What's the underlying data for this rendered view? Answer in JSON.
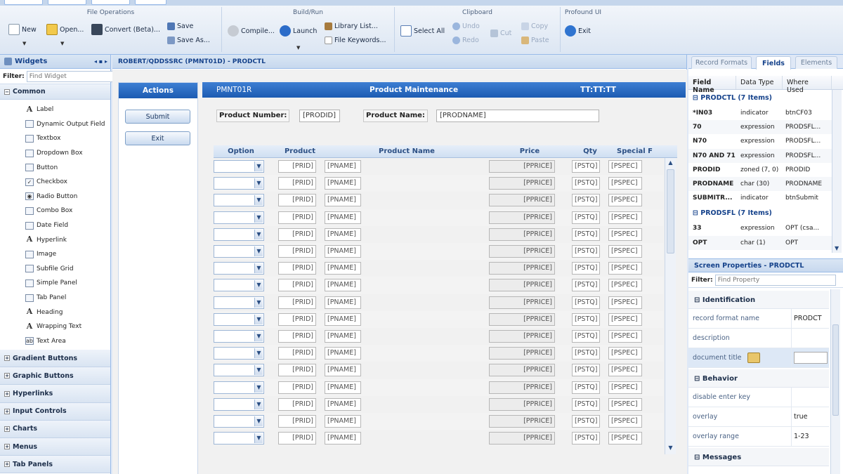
{
  "ribbon": {
    "groups": {
      "file_operations": "File Operations",
      "build_run": "Build/Run",
      "clipboard": "Clipboard",
      "profound_ui": "Profound UI"
    },
    "buttons": {
      "new": "New",
      "open": "Open...",
      "convert": "Convert (Beta)...",
      "save": "Save",
      "save_as": "Save As...",
      "compile": "Compile...",
      "launch": "Launch",
      "library_list": "Library List...",
      "file_keywords": "File Keywords...",
      "select_all": "Select All",
      "undo": "Undo",
      "redo": "Redo",
      "cut": "Cut",
      "copy": "Copy",
      "paste": "Paste",
      "exit": "Exit"
    }
  },
  "widgets": {
    "title": "Widgets",
    "filter_label": "Filter:",
    "filter_placeholder": "Find Widget",
    "common_label": "Common",
    "items": [
      {
        "label": "Label",
        "icon": "A"
      },
      {
        "label": "Dynamic Output Field",
        "icon": ""
      },
      {
        "label": "Textbox",
        "icon": ""
      },
      {
        "label": "Dropdown Box",
        "icon": ""
      },
      {
        "label": "Button",
        "icon": ""
      },
      {
        "label": "Checkbox",
        "icon": "✓"
      },
      {
        "label": "Radio Button",
        "icon": "◉"
      },
      {
        "label": "Combo Box",
        "icon": ""
      },
      {
        "label": "Date Field",
        "icon": ""
      },
      {
        "label": "Hyperlink",
        "icon": "A"
      },
      {
        "label": "Image",
        "icon": ""
      },
      {
        "label": "Subfile Grid",
        "icon": ""
      },
      {
        "label": "Simple Panel",
        "icon": ""
      },
      {
        "label": "Tab Panel",
        "icon": ""
      },
      {
        "label": "Heading",
        "icon": "A"
      },
      {
        "label": "Wrapping Text",
        "icon": "A"
      },
      {
        "label": "Text Area",
        "icon": "ab"
      }
    ],
    "sections": [
      "Gradient Buttons",
      "Graphic Buttons",
      "Hyperlinks",
      "Input Controls",
      "Charts",
      "Menus",
      "Tab Panels"
    ]
  },
  "canvas": {
    "path": "ROBERT/QDDSSRC (PMNT01D) - PRODCTL",
    "actions_title": "Actions",
    "submit_label": "Submit",
    "exit_label": "Exit",
    "form_record": "PMNT01R",
    "form_title": "Product Maintenance",
    "form_time": "TT:TT:TT",
    "product_number_label": "Product Number:",
    "product_number_value": "[PRODID]",
    "product_name_label": "Product Name:",
    "product_name_value": "[PRODNAME]",
    "grid": {
      "headers": [
        "Option",
        "Product",
        "Product Name",
        "Price",
        "Qty",
        "Special F"
      ],
      "row_count": 17,
      "cells": {
        "prid": "[PRID]",
        "pname": "[PNAME]",
        "pprice": "[PPRICE]",
        "pstq": "[PSTQ]",
        "pspec": "[PSPEC]"
      }
    }
  },
  "right": {
    "tabs": [
      "Record Formats",
      "Fields",
      "Elements"
    ],
    "active_tab": "Fields",
    "field_columns": [
      "Field Name",
      "Data Type",
      "Where Used"
    ],
    "groups": [
      {
        "title": "PRODCTL (7 Items)",
        "rows": [
          [
            "*IN03",
            "indicator",
            "btnCF03"
          ],
          [
            "70",
            "expression",
            "PRODSFL..."
          ],
          [
            "N70",
            "expression",
            "PRODSFL..."
          ],
          [
            "N70 AND 71",
            "expression",
            "PRODSFL..."
          ],
          [
            "PRODID",
            "zoned (7, 0)",
            "PRODID"
          ],
          [
            "PRODNAME",
            "char (30)",
            "PRODNAME"
          ],
          [
            "SUBMITR...",
            "indicator",
            "btnSubmit"
          ]
        ]
      },
      {
        "title": "PRODSFL (7 Items)",
        "rows": [
          [
            "33",
            "expression",
            "OPT (csa..."
          ],
          [
            "OPT",
            "char (1)",
            "OPT"
          ]
        ]
      }
    ],
    "screen_props": {
      "title": "Screen Properties - PRODCTL",
      "filter_label": "Filter:",
      "filter_placeholder": "Find Property",
      "sections": {
        "identification": "Identification",
        "behavior": "Behavior",
        "messages": "Messages"
      },
      "props": {
        "record_format_name": {
          "k": "record format name",
          "v": "PRODCT"
        },
        "description": {
          "k": "description",
          "v": ""
        },
        "document_title": {
          "k": "document title",
          "v": ""
        },
        "disable_enter_key": {
          "k": "disable enter key",
          "v": ""
        },
        "overlay": {
          "k": "overlay",
          "v": "true"
        },
        "overlay_range": {
          "k": "overlay range",
          "v": "1-23"
        }
      }
    }
  },
  "colors": {
    "accent": "#1c5bb2",
    "panel_header": "#c7d8ee",
    "border": "#99bbe8"
  }
}
